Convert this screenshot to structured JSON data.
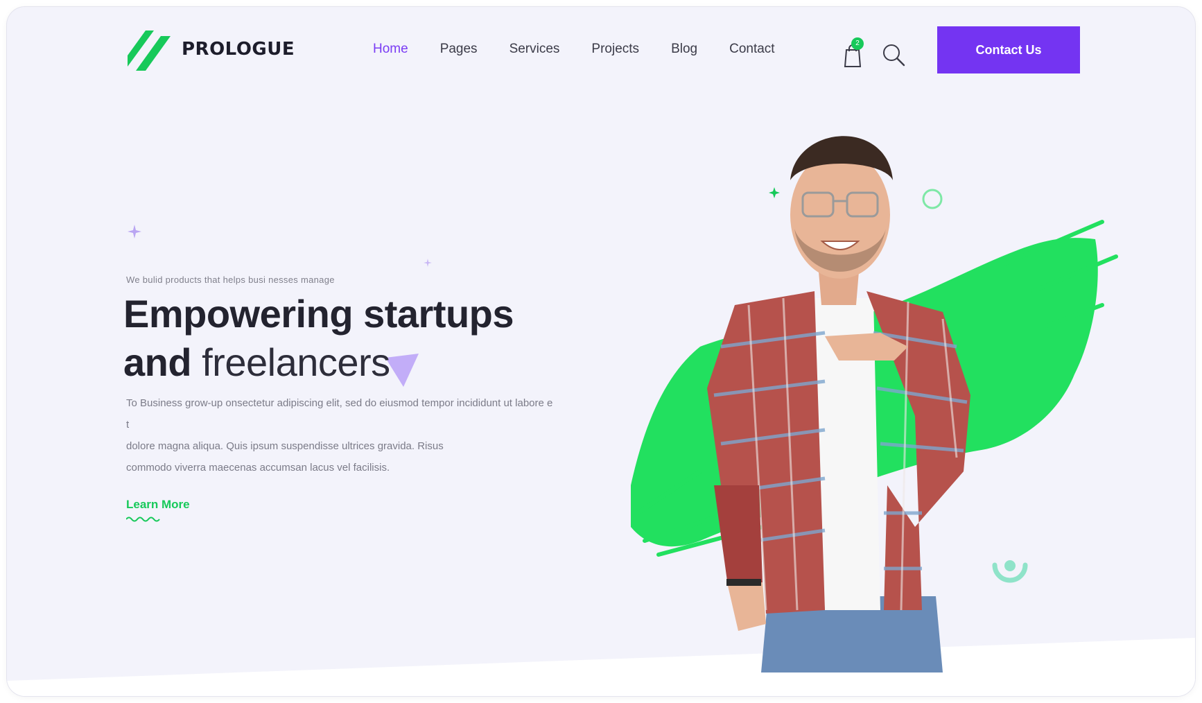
{
  "brand": {
    "name": "PROLOGUE"
  },
  "nav": {
    "items": [
      {
        "label": "Home",
        "active": true
      },
      {
        "label": "Pages",
        "active": false
      },
      {
        "label": "Services",
        "active": false
      },
      {
        "label": "Projects",
        "active": false
      },
      {
        "label": "Blog",
        "active": false
      },
      {
        "label": "Contact",
        "active": false
      }
    ]
  },
  "header": {
    "cart_icon": "shopping-bag-icon",
    "cart_count": "2",
    "search_icon": "search-icon",
    "cta_label": "Contact Us"
  },
  "hero": {
    "eyebrow": "We bulid products that helps busi nesses manage",
    "headline_line1": "Empowering startups",
    "headline_and": "and",
    "headline_light": "freelancers",
    "body_line1": "To Business grow-up onsectetur adipiscing elit, sed do eiusmod tempor incididunt ut labore e",
    "body_line2": "t",
    "body_line3": "dolore magna aliqua. Quis ipsum suspendisse ultrices gravida. Risus",
    "body_line4": "commodo viverra maecenas accumsan lacus vel facilisis.",
    "learn_more": "Learn More"
  },
  "colors": {
    "accent_purple": "#7434f2",
    "accent_green": "#17c95a",
    "background": "#f3f3fb",
    "heading": "#23232f"
  }
}
